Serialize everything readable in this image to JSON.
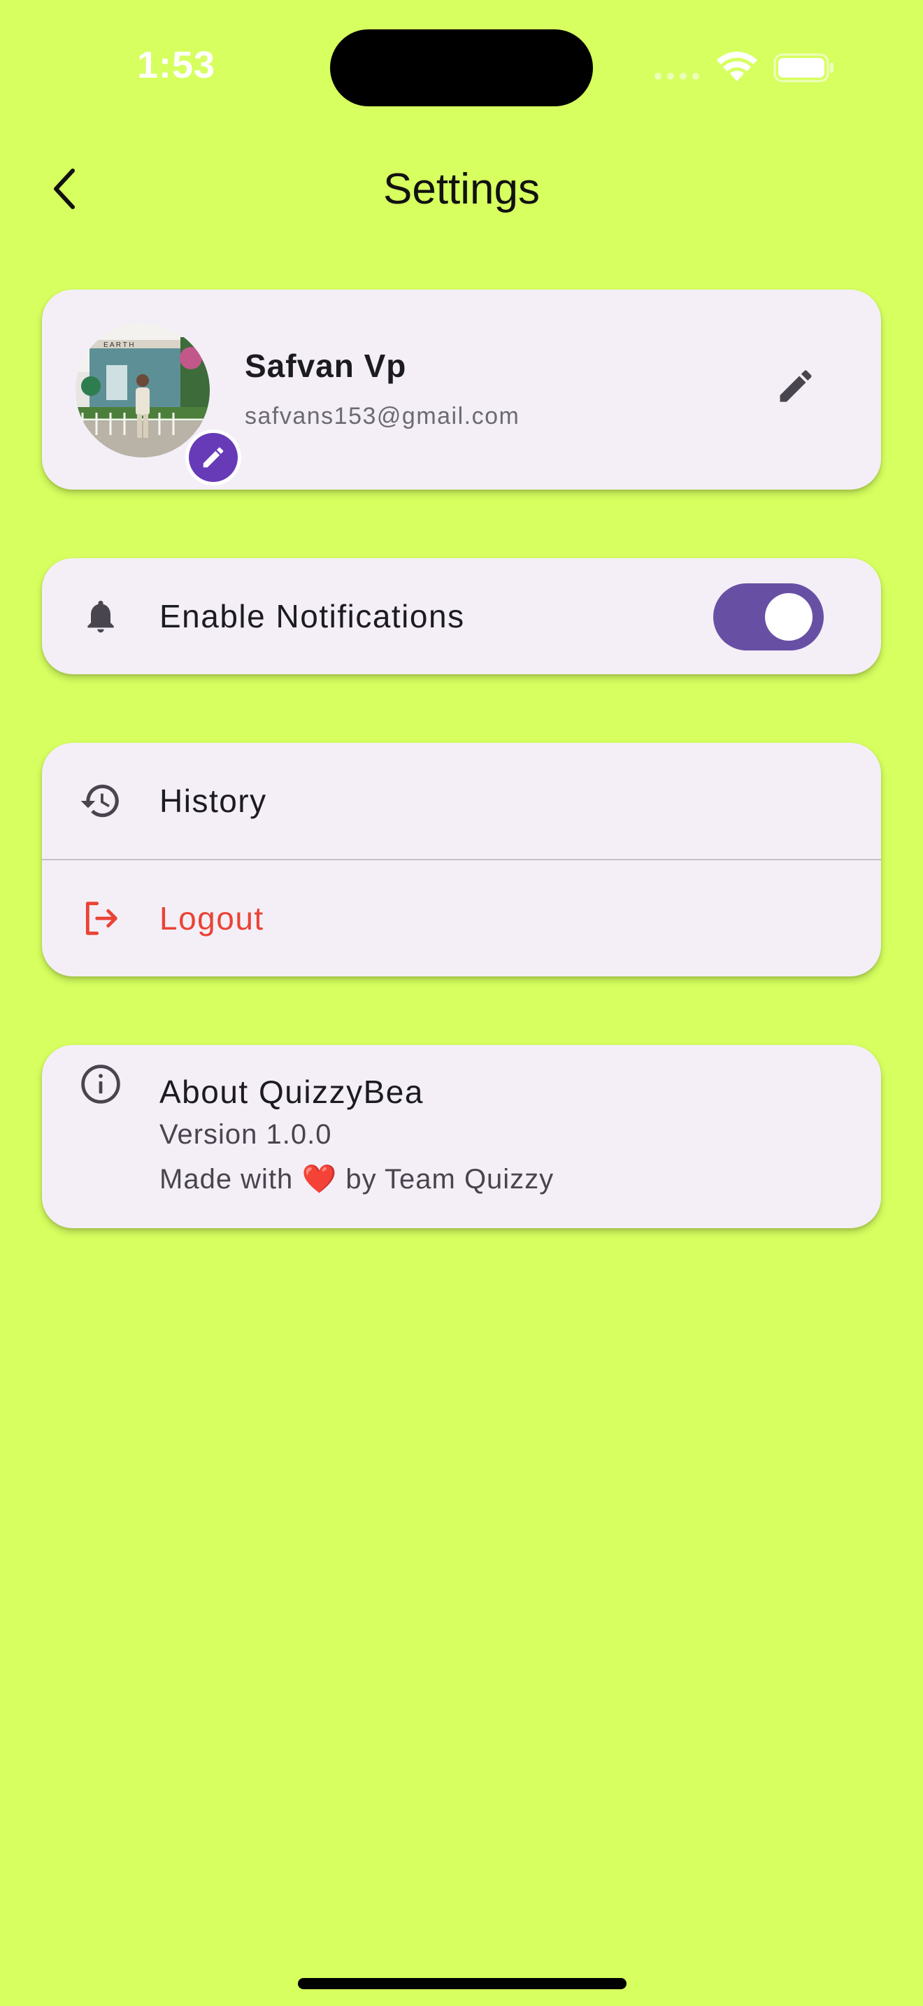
{
  "status_bar": {
    "time": "1:53",
    "icons": [
      "signal-icon",
      "wifi-icon",
      "battery-icon"
    ]
  },
  "app_bar": {
    "title": "Settings",
    "back_icon": "chevron-left-icon"
  },
  "profile": {
    "name": "Safvan Vp",
    "email": "safvans153@gmail.com",
    "avatar_icon": "avatar-photo",
    "avatar_edit_icon": "pencil-icon",
    "edit_icon": "pencil-icon"
  },
  "notifications": {
    "label": "Enable Notifications",
    "icon": "bell-icon",
    "enabled": true
  },
  "menu": {
    "history": {
      "label": "History",
      "icon": "history-icon"
    },
    "logout": {
      "label": "Logout",
      "icon": "logout-icon"
    }
  },
  "about": {
    "title": "About QuizzyBea",
    "version": "Version 1.0.0",
    "made_with_prefix": "Made with",
    "made_with_heart": "❤️",
    "made_with_suffix": "by Team Quizzy",
    "icon": "info-icon"
  },
  "colors": {
    "background": "#d6ff5f",
    "card": "#f4eff7",
    "accent": "#6750a4",
    "avatar_badge": "#673ab7",
    "logout": "#ea4335",
    "icon": "#49454f"
  }
}
